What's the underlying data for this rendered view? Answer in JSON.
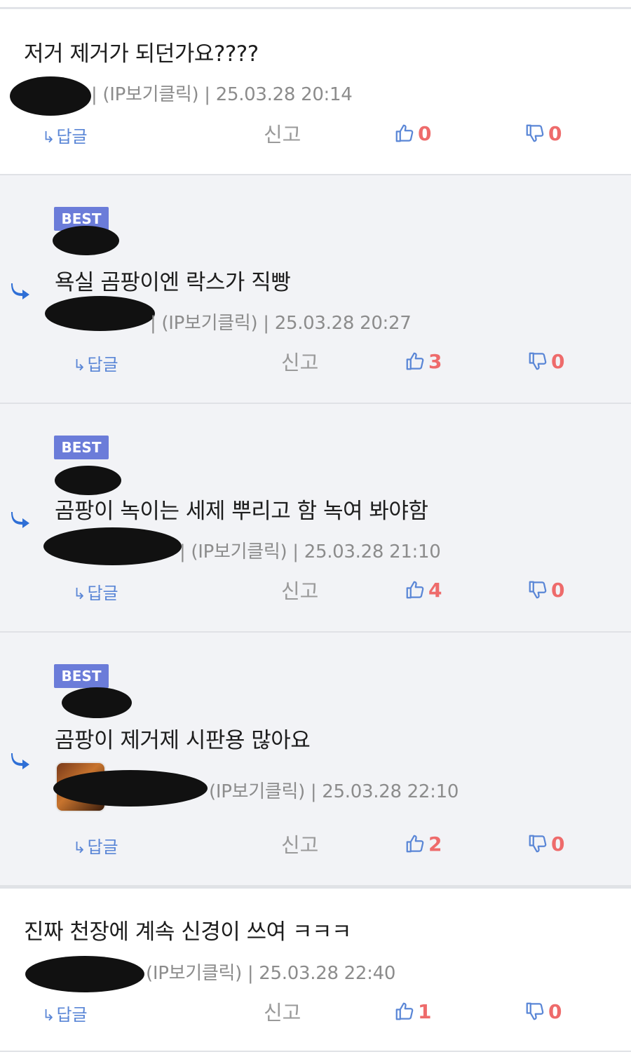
{
  "comments": [
    {
      "type": "plain",
      "best_label": "",
      "text": "저거 제거가 되던가요????",
      "meta": "| (IP보기클릭) | 25.03.28 20:14",
      "reply_label": "답글",
      "report_label": "신고",
      "likes": "0",
      "dislikes": "0"
    },
    {
      "type": "reply",
      "best_label": "BEST",
      "text": "욕실 곰팡이엔 락스가 직빵",
      "meta": "| (IP보기클릭) | 25.03.28 20:27",
      "reply_label": "답글",
      "report_label": "신고",
      "likes": "3",
      "dislikes": "0"
    },
    {
      "type": "reply",
      "best_label": "BEST",
      "text": "곰팡이 녹이는 세제 뿌리고 함 녹여 봐야함",
      "meta": "| (IP보기클릭) | 25.03.28 21:10",
      "reply_label": "답글",
      "report_label": "신고",
      "likes": "4",
      "dislikes": "0"
    },
    {
      "type": "reply",
      "best_label": "BEST",
      "text": "곰팡이 제거제 시판용 많아요",
      "meta": "(IP보기클릭) | 25.03.28 22:10",
      "reply_label": "답글",
      "report_label": "신고",
      "likes": "2",
      "dislikes": "0"
    },
    {
      "type": "plain",
      "best_label": "",
      "text": "진짜 천장에 계속 신경이 쓰여 ㅋㅋㅋ",
      "meta": "(IP보기클릭) | 25.03.28 22:40",
      "reply_label": "답글",
      "report_label": "신고",
      "likes": "1",
      "dislikes": "0"
    }
  ],
  "colors": {
    "best_badge": "#6b7cd9",
    "reply_link": "#5a86d6",
    "vote_count": "#ee6b6b",
    "reply_bg": "#f2f3f6",
    "reply_arrow": "#2f6fd6"
  },
  "icons": {
    "reply_arrow": "reply-arrow-icon",
    "thumb_up": "thumbs-up-icon",
    "thumb_down": "thumbs-down-icon"
  }
}
